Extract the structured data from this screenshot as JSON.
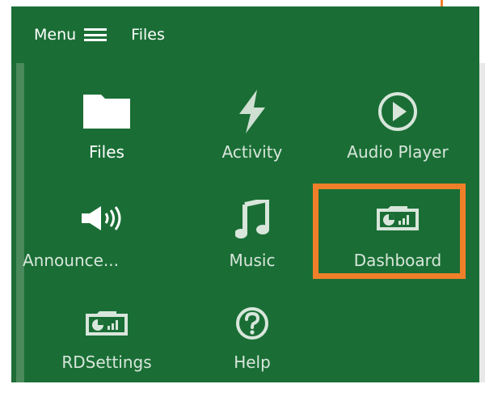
{
  "topbar": {
    "menu_label": "Menu",
    "title": "Files"
  },
  "tiles": [
    {
      "label": "Files",
      "icon": "folder-icon"
    },
    {
      "label": "Activity",
      "icon": "lightning-icon"
    },
    {
      "label": "Audio Player",
      "icon": "play-circle-icon"
    },
    {
      "label": "Announce...",
      "icon": "speaker-icon"
    },
    {
      "label": "Music",
      "icon": "music-note-icon"
    },
    {
      "label": "Dashboard",
      "icon": "dashboard-icon"
    },
    {
      "label": "RDSettings",
      "icon": "dashboard-icon"
    },
    {
      "label": "Help",
      "icon": "question-circle-icon"
    }
  ],
  "colors": {
    "panel_green": "#1a6e35",
    "highlight_orange": "#f07f2a",
    "text": "#ffffff"
  }
}
